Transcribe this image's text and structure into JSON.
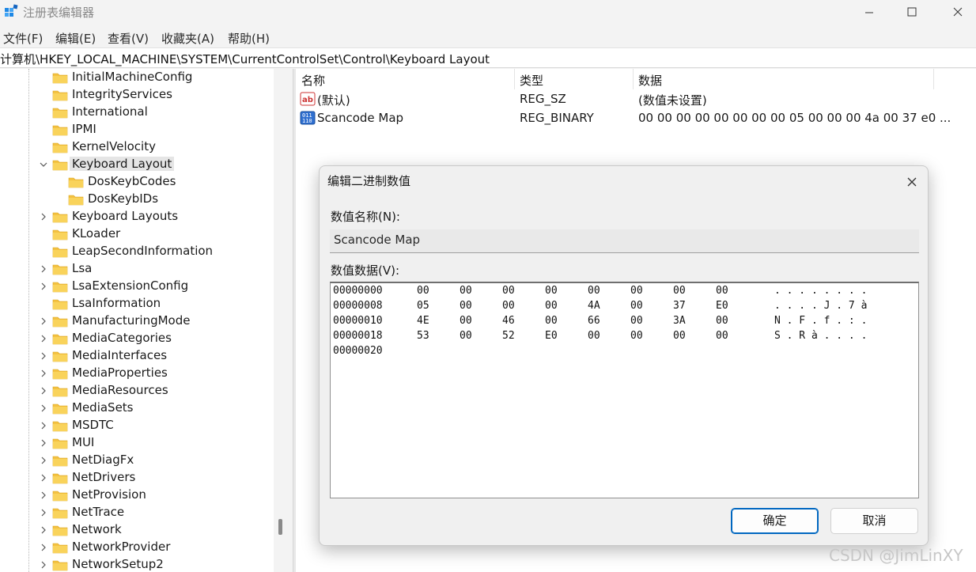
{
  "window": {
    "title": "注册表编辑器"
  },
  "menu": [
    "文件(F)",
    "编辑(E)",
    "查看(V)",
    "收藏夹(A)",
    "帮助(H)"
  ],
  "address": "计算机\\HKEY_LOCAL_MACHINE\\SYSTEM\\CurrentControlSet\\Control\\Keyboard Layout",
  "tree": {
    "items": [
      {
        "label": "InitialMachineConfig",
        "expander": "none",
        "level": 1
      },
      {
        "label": "IntegrityServices",
        "expander": "none",
        "level": 1
      },
      {
        "label": "International",
        "expander": "none",
        "level": 1
      },
      {
        "label": "IPMI",
        "expander": "none",
        "level": 1
      },
      {
        "label": "KernelVelocity",
        "expander": "none",
        "level": 1
      },
      {
        "label": "Keyboard Layout",
        "expander": "expanded",
        "level": 1,
        "selected": true
      },
      {
        "label": "DosKeybCodes",
        "expander": "none",
        "level": 2
      },
      {
        "label": "DosKeybIDs",
        "expander": "none",
        "level": 2
      },
      {
        "label": "Keyboard Layouts",
        "expander": "collapsed",
        "level": 1
      },
      {
        "label": "KLoader",
        "expander": "none",
        "level": 1
      },
      {
        "label": "LeapSecondInformation",
        "expander": "none",
        "level": 1
      },
      {
        "label": "Lsa",
        "expander": "collapsed",
        "level": 1
      },
      {
        "label": "LsaExtensionConfig",
        "expander": "collapsed",
        "level": 1
      },
      {
        "label": "LsaInformation",
        "expander": "none",
        "level": 1
      },
      {
        "label": "ManufacturingMode",
        "expander": "collapsed",
        "level": 1
      },
      {
        "label": "MediaCategories",
        "expander": "collapsed",
        "level": 1
      },
      {
        "label": "MediaInterfaces",
        "expander": "collapsed",
        "level": 1
      },
      {
        "label": "MediaProperties",
        "expander": "collapsed",
        "level": 1
      },
      {
        "label": "MediaResources",
        "expander": "collapsed",
        "level": 1
      },
      {
        "label": "MediaSets",
        "expander": "collapsed",
        "level": 1
      },
      {
        "label": "MSDTC",
        "expander": "collapsed",
        "level": 1
      },
      {
        "label": "MUI",
        "expander": "collapsed",
        "level": 1
      },
      {
        "label": "NetDiagFx",
        "expander": "collapsed",
        "level": 1
      },
      {
        "label": "NetDrivers",
        "expander": "collapsed",
        "level": 1
      },
      {
        "label": "NetProvision",
        "expander": "collapsed",
        "level": 1
      },
      {
        "label": "NetTrace",
        "expander": "collapsed",
        "level": 1
      },
      {
        "label": "Network",
        "expander": "collapsed",
        "level": 1
      },
      {
        "label": "NetworkProvider",
        "expander": "collapsed",
        "level": 1
      },
      {
        "label": "NetworkSetup2",
        "expander": "collapsed",
        "level": 1
      }
    ]
  },
  "list": {
    "columns": [
      "名称",
      "类型",
      "数据"
    ],
    "rows": [
      {
        "icon": "string-value-icon",
        "name": "(默认)",
        "type": "REG_SZ",
        "data": "(数值未设置)"
      },
      {
        "icon": "binary-value-icon",
        "name": "Scancode Map",
        "type": "REG_BINARY",
        "data": "00 00 00 00 00 00 00 00 05 00 00 00 4a 00 37 e0 ..."
      }
    ]
  },
  "dialog": {
    "title": "编辑二进制数值",
    "name_label": "数值名称(N):",
    "name_value": "Scancode Map",
    "data_label": "数值数据(V):",
    "hex_rows": [
      {
        "offset": "00000000",
        "bytes": [
          "00",
          "00",
          "00",
          "00",
          "00",
          "00",
          "00",
          "00"
        ],
        "ascii": ". . . . . . . ."
      },
      {
        "offset": "00000008",
        "bytes": [
          "05",
          "00",
          "00",
          "00",
          "4A",
          "00",
          "37",
          "E0"
        ],
        "ascii": ". . . . J . 7 à"
      },
      {
        "offset": "00000010",
        "bytes": [
          "4E",
          "00",
          "46",
          "00",
          "66",
          "00",
          "3A",
          "00"
        ],
        "ascii": "N . F . f . : ."
      },
      {
        "offset": "00000018",
        "bytes": [
          "53",
          "00",
          "52",
          "E0",
          "00",
          "00",
          "00",
          "00"
        ],
        "ascii": "S . R à . . . ."
      },
      {
        "offset": "00000020",
        "bytes": [],
        "ascii": ""
      }
    ],
    "ok_label": "确定",
    "cancel_label": "取消"
  },
  "watermark": "CSDN @JimLinXY",
  "colors": {
    "folder": "#f4c242",
    "accent": "#0067c0",
    "selection": "#e5e5e5"
  }
}
